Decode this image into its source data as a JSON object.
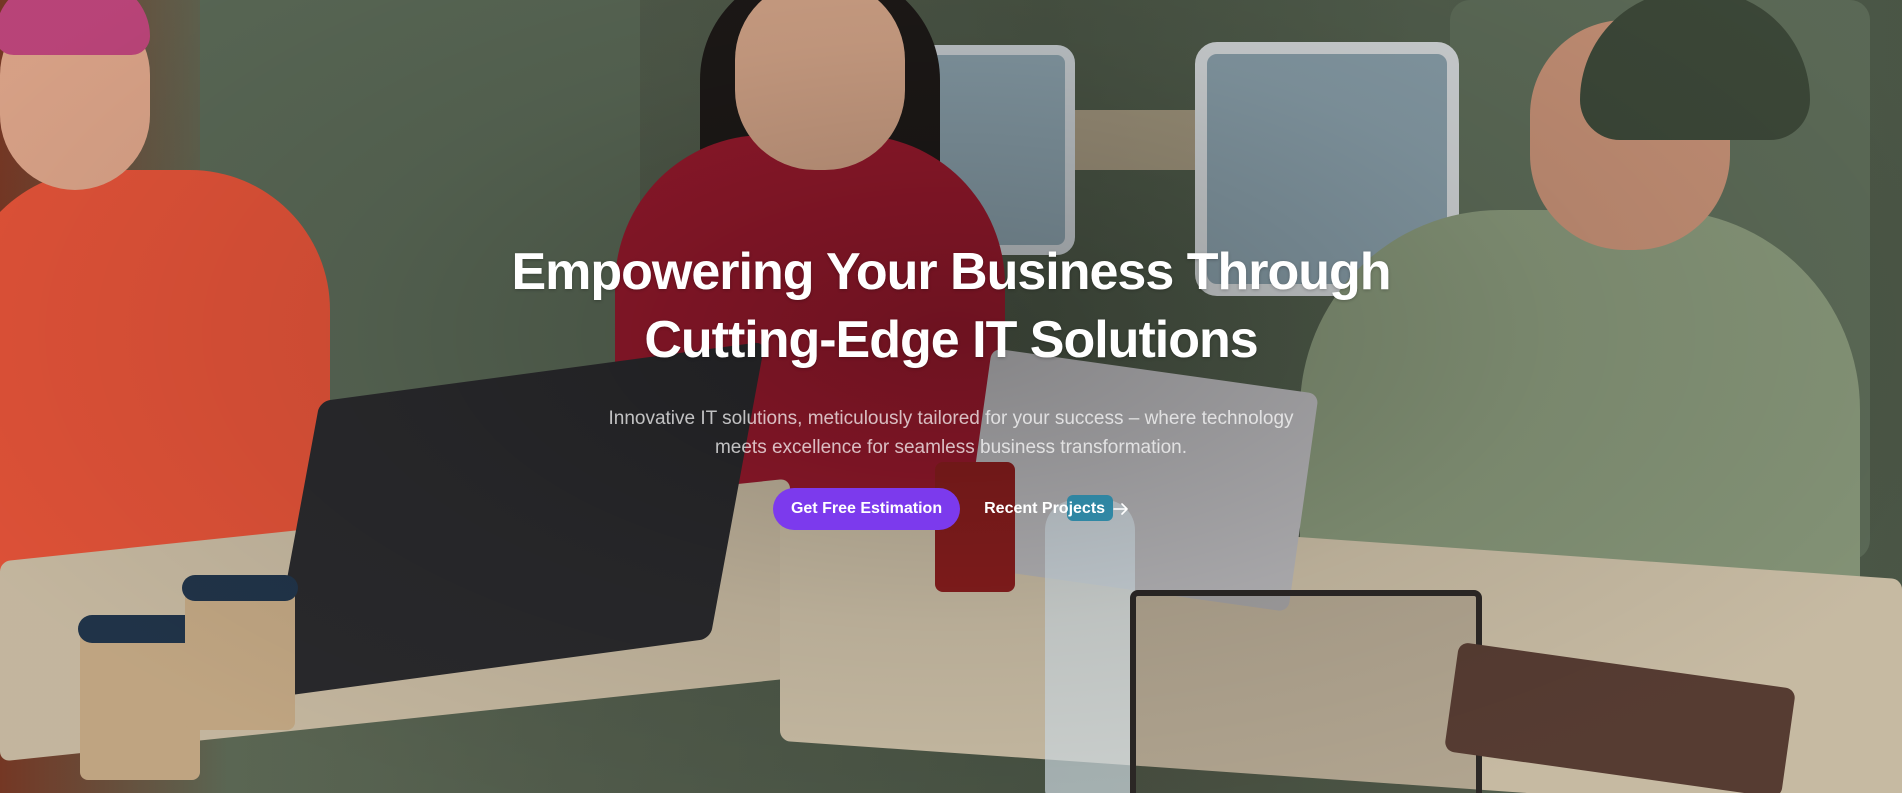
{
  "hero": {
    "headline_line1": "Empowering Your Business Through",
    "headline_line2": "Cutting-Edge IT Solutions",
    "subtext_line1": "Innovative IT solutions, meticulously tailored for your success – where technology",
    "subtext_line2": "meets excellence for seamless business transformation.",
    "primary_button_label": "Get Free Estimation",
    "secondary_link_label": "Recent Projects",
    "secondary_link_icon": "arrow-right-icon"
  },
  "colors": {
    "accent": "#7c3aed",
    "text": "#ffffff"
  }
}
